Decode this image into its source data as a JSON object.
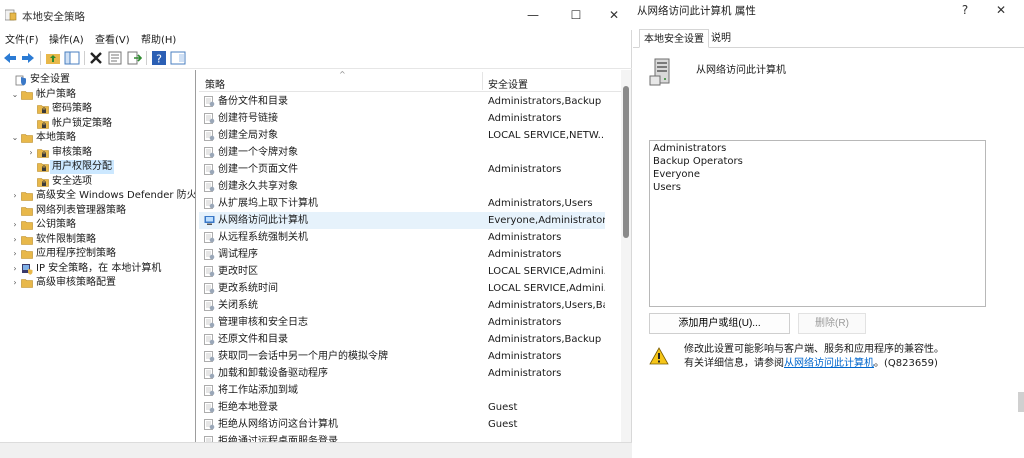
{
  "main_window": {
    "title": "本地安全策略",
    "controls": {
      "minimize": "—",
      "maximize": "☐",
      "close": "✕"
    }
  },
  "menu": [
    "文件(F)",
    "操作(A)",
    "查看(V)",
    "帮助(H)"
  ],
  "toolbar_icons": [
    "back-icon",
    "forward-icon",
    "up-folder-icon",
    "show-tree-icon",
    "delete-icon",
    "properties-icon",
    "export-icon",
    "help-icon",
    "console-icon"
  ],
  "tree": [
    {
      "label": "安全设置",
      "chev": "",
      "icon": "shield",
      "level": 0
    },
    {
      "label": "帐户策略",
      "chev": "v",
      "icon": "folder",
      "level": 1
    },
    {
      "label": "密码策略",
      "chev": "",
      "icon": "lockfolder",
      "level": 2
    },
    {
      "label": "帐户锁定策略",
      "chev": "",
      "icon": "lockfolder",
      "level": 2
    },
    {
      "label": "本地策略",
      "chev": "v",
      "icon": "folder",
      "level": 1
    },
    {
      "label": "审核策略",
      "chev": ">",
      "icon": "lockfolder",
      "level": 2
    },
    {
      "label": "用户权限分配",
      "chev": "",
      "icon": "lockfolder",
      "level": 2,
      "selected": true
    },
    {
      "label": "安全选项",
      "chev": "",
      "icon": "lockfolder",
      "level": 2
    },
    {
      "label": "高级安全 Windows Defender 防火墙",
      "chev": ">",
      "icon": "folder",
      "level": 1
    },
    {
      "label": "网络列表管理器策略",
      "chev": "",
      "icon": "folder",
      "level": 1
    },
    {
      "label": "公钥策略",
      "chev": ">",
      "icon": "folder",
      "level": 1
    },
    {
      "label": "软件限制策略",
      "chev": ">",
      "icon": "folder",
      "level": 1
    },
    {
      "label": "应用程序控制策略",
      "chev": ">",
      "icon": "folder",
      "level": 1
    },
    {
      "label": "IP 安全策略，在 本地计算机",
      "chev": ">",
      "icon": "ipsec",
      "level": 1
    },
    {
      "label": "高级审核策略配置",
      "chev": ">",
      "icon": "folder",
      "level": 1
    }
  ],
  "list": {
    "columns": [
      "策略",
      "安全设置"
    ],
    "rows": [
      {
        "name": "备份文件和目录",
        "value": "Administrators,Backup ..."
      },
      {
        "name": "创建符号链接",
        "value": "Administrators"
      },
      {
        "name": "创建全局对象",
        "value": "LOCAL SERVICE,NETW..."
      },
      {
        "name": "创建一个令牌对象",
        "value": ""
      },
      {
        "name": "创建一个页面文件",
        "value": "Administrators"
      },
      {
        "name": "创建永久共享对象",
        "value": ""
      },
      {
        "name": "从扩展坞上取下计算机",
        "value": "Administrators,Users"
      },
      {
        "name": "从网络访问此计算机",
        "value": "Everyone,Administrator...",
        "selected": true
      },
      {
        "name": "从远程系统强制关机",
        "value": "Administrators"
      },
      {
        "name": "调试程序",
        "value": "Administrators"
      },
      {
        "name": "更改时区",
        "value": "LOCAL SERVICE,Admini..."
      },
      {
        "name": "更改系统时间",
        "value": "LOCAL SERVICE,Admini..."
      },
      {
        "name": "关闭系统",
        "value": "Administrators,Users,Ba..."
      },
      {
        "name": "管理审核和安全日志",
        "value": "Administrators"
      },
      {
        "name": "还原文件和目录",
        "value": "Administrators,Backup ..."
      },
      {
        "name": "获取同一会话中另一个用户的模拟令牌",
        "value": "Administrators"
      },
      {
        "name": "加载和卸载设备驱动程序",
        "value": "Administrators"
      },
      {
        "name": "将工作站添加到域",
        "value": ""
      },
      {
        "name": "拒绝本地登录",
        "value": "Guest"
      },
      {
        "name": "拒绝从网络访问这台计算机",
        "value": "Guest"
      },
      {
        "name": "拒绝通过远程桌面服务登录",
        "value": ""
      }
    ]
  },
  "dialog": {
    "title": "从网络访问此计算机 属性",
    "help": "?",
    "close": "✕",
    "tabs": [
      "本地安全设置",
      "说明"
    ],
    "heading": "从网络访问此计算机",
    "members": [
      "Administrators",
      "Backup Operators",
      "Everyone",
      "Users"
    ],
    "add_button": "添加用户或组(U)...",
    "remove_button": "删除(R)",
    "warning_line1": "修改此设置可能影响与客户端、服务和应用程序的兼容性。",
    "warning_prefix": "有关详细信息，请参阅",
    "warning_link": "从网络访问此计算机",
    "warning_suffix": "。(Q823659)"
  },
  "colors": {
    "selection": "#cce8ff",
    "row_selected": "#e6f2fb",
    "link": "#0066cc",
    "folder": "#e8b84a"
  }
}
